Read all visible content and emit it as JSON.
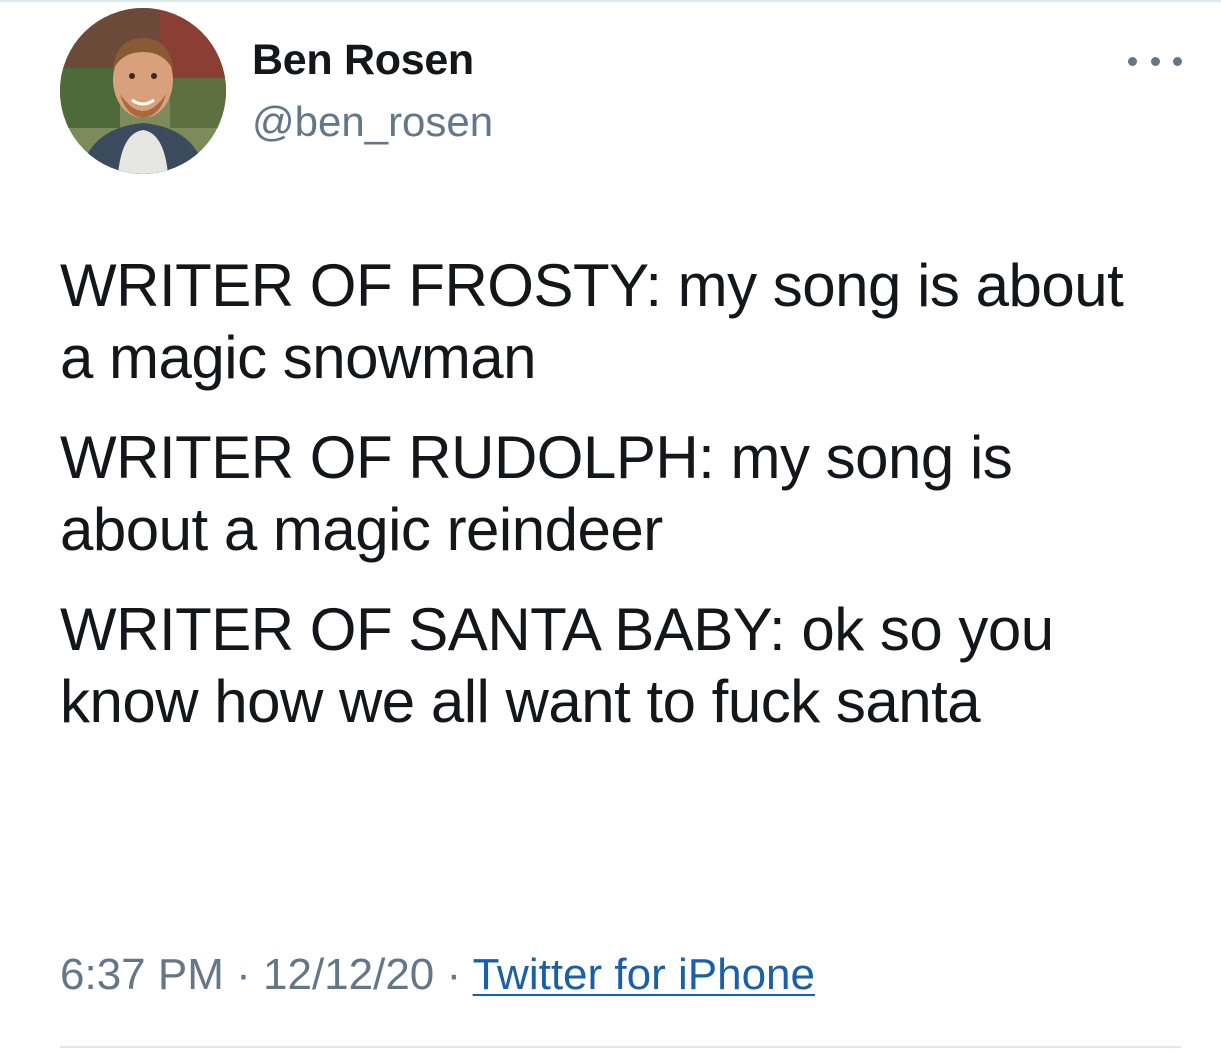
{
  "user": {
    "display_name": "Ben Rosen",
    "handle": "@ben_rosen"
  },
  "tweet": {
    "paragraphs": [
      "WRITER OF FROSTY: my song is about a magic snowman",
      "WRITER OF RUDOLPH: my song is about a magic reindeer",
      "WRITER OF SANTA BABY: ok so you know how we all want to fuck santa"
    ]
  },
  "meta": {
    "time": "6:37 PM",
    "separator": "·",
    "date": "12/12/20",
    "source": "Twitter for iPhone"
  },
  "icons": {
    "more": "more-horizontal-icon",
    "avatar": "profile-photo"
  },
  "colors": {
    "text": "#14171a",
    "secondary": "#657786",
    "link": "#1b5fa8",
    "divider": "#e1e8ed"
  }
}
